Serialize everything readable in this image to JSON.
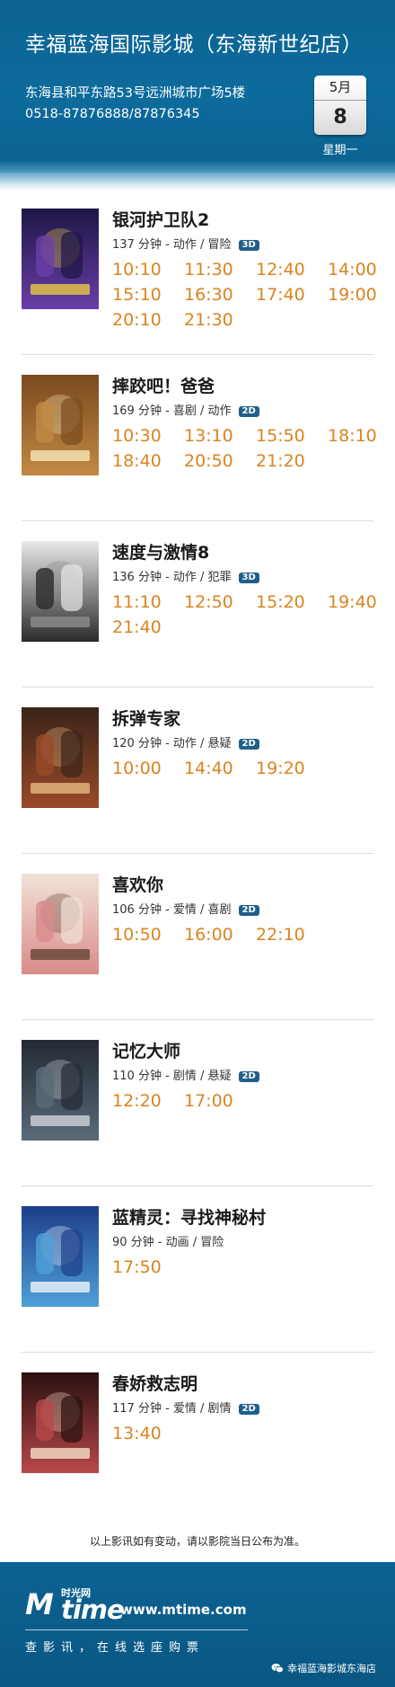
{
  "header": {
    "title": "幸福蓝海国际影城（东海新世纪店）",
    "address": "东海县和平东路53号远洲城市广场5楼",
    "phone": "0518-87876888/87876345",
    "date_month": "5月",
    "date_day": "8",
    "weekday": "星期一"
  },
  "movies": [
    {
      "title": "银河护卫队2",
      "duration": "137 分钟",
      "genre": "动作 / 冒险",
      "format": "3D",
      "times": [
        "10:10",
        "11:30",
        "12:40",
        "14:00",
        "15:10",
        "16:30",
        "17:40",
        "19:00",
        "20:10",
        "21:30"
      ]
    },
    {
      "title": "摔跤吧！爸爸",
      "duration": "169 分钟",
      "genre": "喜剧 / 动作",
      "format": "2D",
      "times": [
        "10:30",
        "13:10",
        "15:50",
        "18:10",
        "18:40",
        "20:50",
        "21:20"
      ]
    },
    {
      "title": "速度与激情8",
      "duration": "136 分钟",
      "genre": "动作 / 犯罪",
      "format": "3D",
      "times": [
        "11:10",
        "12:50",
        "15:20",
        "19:40",
        "21:40"
      ]
    },
    {
      "title": "拆弹专家",
      "duration": "120 分钟",
      "genre": "动作 / 悬疑",
      "format": "2D",
      "times": [
        "10:00",
        "14:40",
        "19:20"
      ]
    },
    {
      "title": "喜欢你",
      "duration": "106 分钟",
      "genre": "爱情 / 喜剧",
      "format": "2D",
      "times": [
        "10:50",
        "16:00",
        "22:10"
      ]
    },
    {
      "title": "记忆大师",
      "duration": "110 分钟",
      "genre": "剧情 / 悬疑",
      "format": "2D",
      "times": [
        "12:20",
        "17:00"
      ]
    },
    {
      "title": "蓝精灵：寻找神秘村",
      "duration": "90 分钟",
      "genre": "动画 / 冒险",
      "format": "",
      "times": [
        "17:50"
      ]
    },
    {
      "title": "春娇救志明",
      "duration": "117 分钟",
      "genre": "爱情 / 剧情",
      "format": "2D",
      "times": [
        "13:40"
      ]
    }
  ],
  "notice": "以上影讯如有变动，请以影院当日公布为准。",
  "footer": {
    "logo_m": "M",
    "logo_word": "time",
    "logo_cn": "时光网",
    "url": "www.mtime.com",
    "slogan": "查影讯，在线选座购票",
    "wechat_account": "幸福蓝海影城东海店"
  },
  "colors": {
    "header_bg": "#0c6392",
    "showtime": "#d9841f",
    "format_badge": "#1f5f8a"
  },
  "icons": [
    "wechat-icon"
  ]
}
